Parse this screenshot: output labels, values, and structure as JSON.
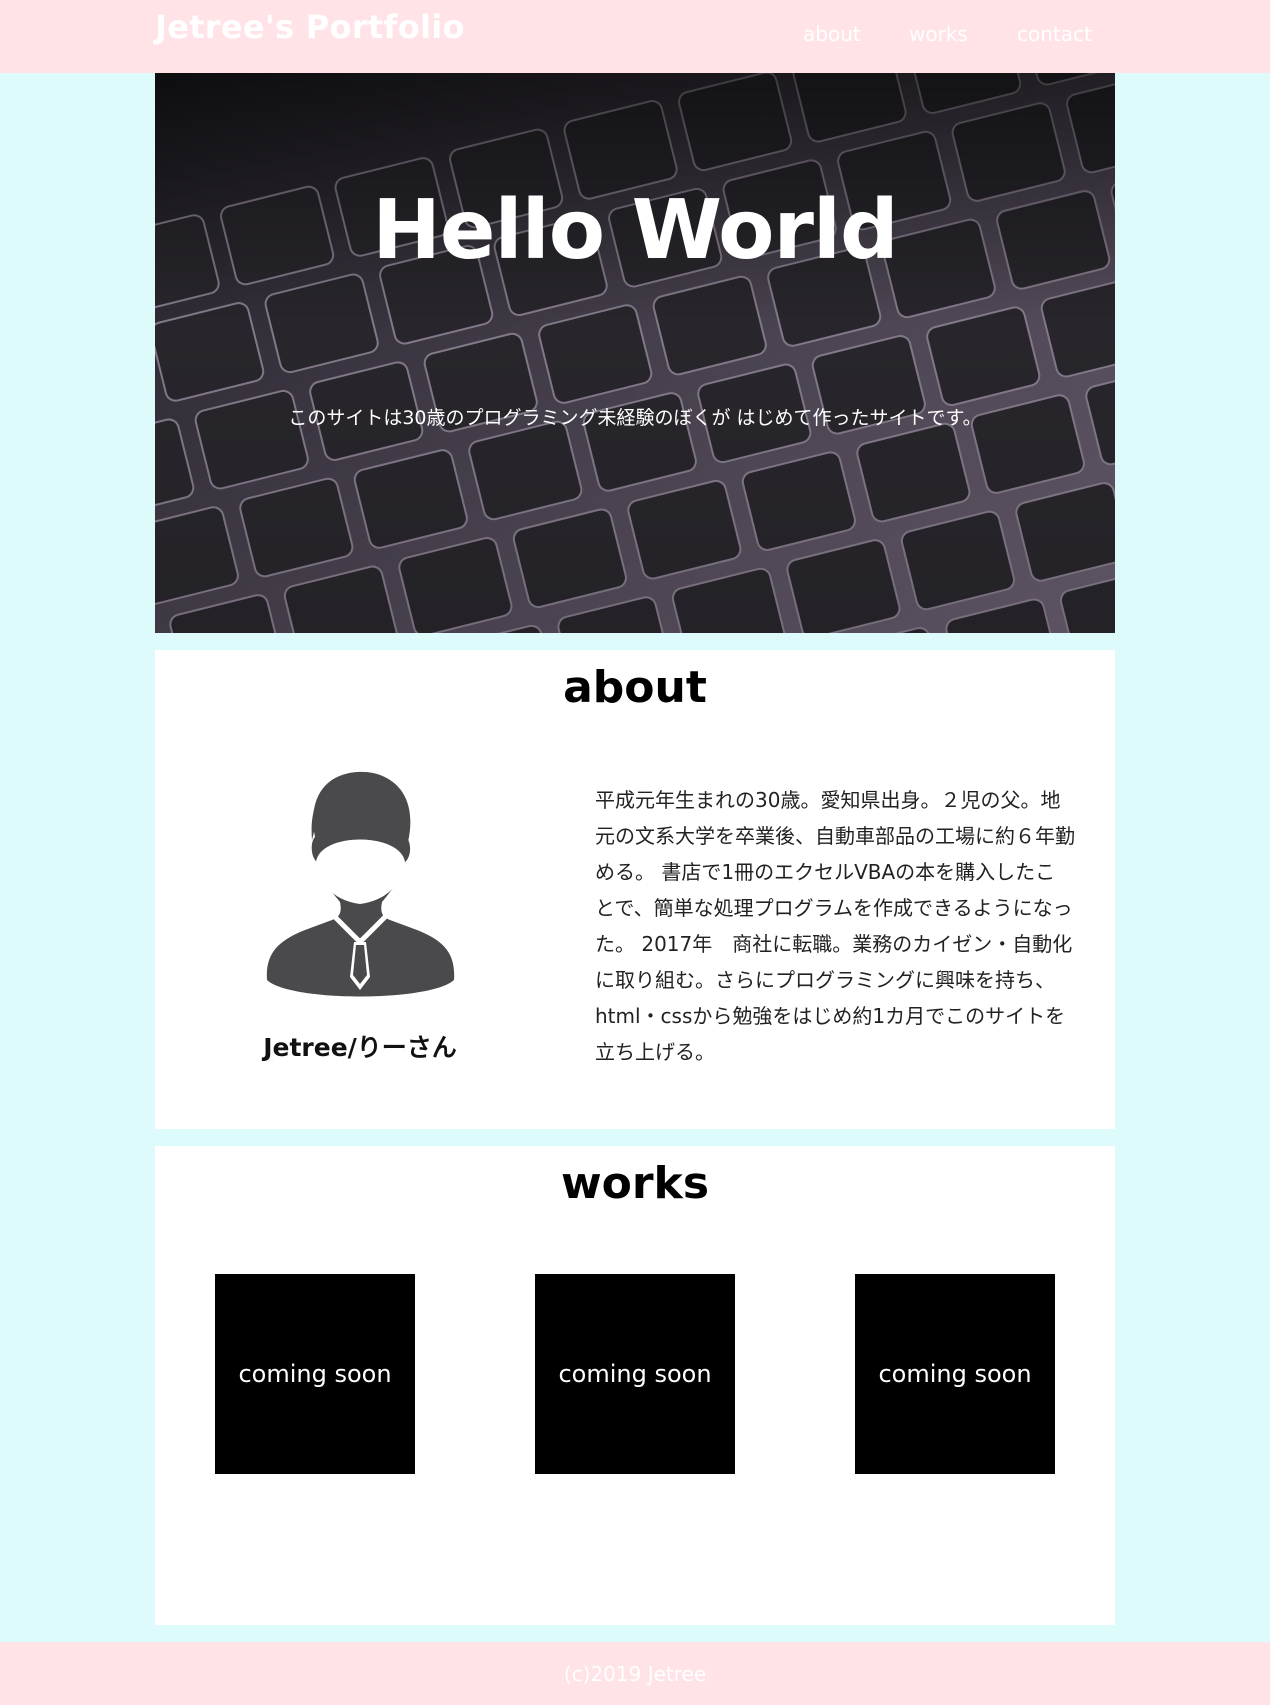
{
  "header": {
    "site_title": "Jetree's Portfolio",
    "nav": [
      "about",
      "works",
      "contact"
    ]
  },
  "hero": {
    "title": "Hello World",
    "subtitle": "このサイトは30歳のプログラミング未経験のぼくが はじめて作ったサイトです。"
  },
  "about": {
    "heading": "about",
    "name": "Jetree/りーさん",
    "bio": "平成元年生まれの30歳。愛知県出身。２児の父。地元の文系大学を卒業後、自動車部品の工場に約６年勤める。 書店で1冊のエクセルVBAの本を購入したことで、簡単な処理プログラムを作成できるようになった。 2017年　商社に転職。業務のカイゼン・自動化に取り組む。さらにプログラミングに興味を持ち、html・cssから勉強をはじめ約1カ月でこのサイトを立ち上げる。"
  },
  "works": {
    "heading": "works",
    "items": [
      "coming soon",
      "coming soon",
      "coming soon"
    ]
  },
  "footer": {
    "copyright": "(c)2019 Jetree"
  },
  "colors": {
    "page_background": "#ddfbfb",
    "header_footer": "#ffe3e7",
    "panel": "#ffffff",
    "work_card": "#000000",
    "avatar": "#4a4a4c"
  }
}
